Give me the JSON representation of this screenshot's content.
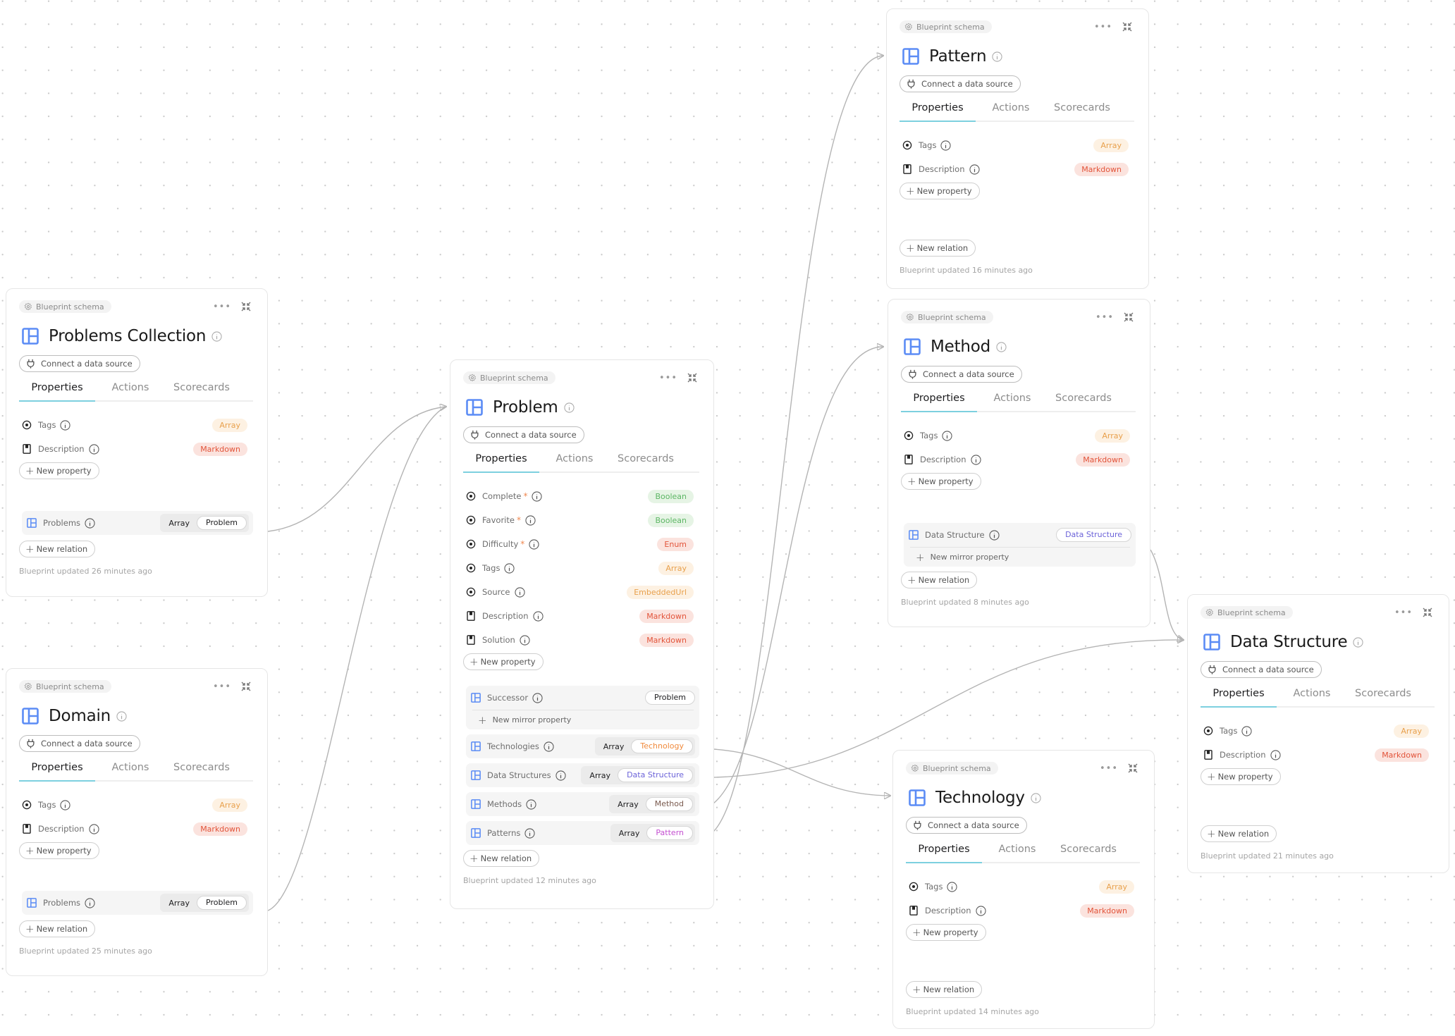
{
  "common": {
    "schema_chip": "Blueprint schema",
    "connect_label": "Connect a data source",
    "tabs": [
      "Properties",
      "Actions",
      "Scorecards"
    ],
    "new_property": "New property",
    "new_relation": "New relation",
    "new_mirror_property": "New mirror property",
    "array_label": "Array",
    "more_icon": "more-horizontal-icon",
    "collapse_icon": "collapse-icon",
    "colors": {
      "accent_tab": "#7dd0df",
      "blueprint_icon": "#5b8cf5",
      "array_badge": "#e8a04c",
      "markdown_badge": "#e2543a",
      "boolean_badge": "#5cb664",
      "enum_badge": "#e2543a"
    }
  },
  "blueprints": {
    "problems_collection": {
      "title": "Problems Collection",
      "properties": [
        {
          "name": "Tags",
          "icon": "tag-dot-icon",
          "type": "Array"
        },
        {
          "name": "Description",
          "icon": "document-icon",
          "type": "Markdown"
        }
      ],
      "relations": [
        {
          "name": "Problems",
          "many": "Array",
          "target": "Problem"
        }
      ],
      "updated": "Blueprint updated 26 minutes ago"
    },
    "domain": {
      "title": "Domain",
      "properties": [
        {
          "name": "Tags",
          "icon": "tag-dot-icon",
          "type": "Array"
        },
        {
          "name": "Description",
          "icon": "document-icon",
          "type": "Markdown"
        }
      ],
      "relations": [
        {
          "name": "Problems",
          "many": "Array",
          "target": "Problem"
        }
      ],
      "updated": "Blueprint updated 25 minutes ago"
    },
    "problem": {
      "title": "Problem",
      "properties": [
        {
          "name": "Complete",
          "required": "*",
          "icon": "tag-dot-icon",
          "type": "Boolean"
        },
        {
          "name": "Favorite",
          "required": "*",
          "icon": "tag-dot-icon",
          "type": "Boolean"
        },
        {
          "name": "Difficulty",
          "required": "*",
          "icon": "tag-dot-icon",
          "type": "Enum"
        },
        {
          "name": "Tags",
          "icon": "tag-dot-icon",
          "type": "Array"
        },
        {
          "name": "Source",
          "icon": "tag-dot-icon",
          "type": "EmbeddedUrl"
        },
        {
          "name": "Description",
          "icon": "document-icon",
          "type": "Markdown"
        },
        {
          "name": "Solution",
          "icon": "document-icon",
          "type": "Markdown"
        }
      ],
      "relations": [
        {
          "name": "Successor",
          "target": "Problem"
        },
        {
          "name": "Technologies",
          "many": "Array",
          "target": "Technology"
        },
        {
          "name": "Data Structures",
          "many": "Array",
          "target": "Data Structure"
        },
        {
          "name": "Methods",
          "many": "Array",
          "target": "Method"
        },
        {
          "name": "Patterns",
          "many": "Array",
          "target": "Pattern"
        }
      ],
      "updated": "Blueprint updated 12 minutes ago"
    },
    "pattern": {
      "title": "Pattern",
      "properties": [
        {
          "name": "Tags",
          "icon": "tag-dot-icon",
          "type": "Array"
        },
        {
          "name": "Description",
          "icon": "document-icon",
          "type": "Markdown"
        }
      ],
      "updated": "Blueprint updated 16 minutes ago"
    },
    "method": {
      "title": "Method",
      "properties": [
        {
          "name": "Tags",
          "icon": "tag-dot-icon",
          "type": "Array"
        },
        {
          "name": "Description",
          "icon": "document-icon",
          "type": "Markdown"
        }
      ],
      "relations": [
        {
          "name": "Data Structure",
          "target": "Data Structure"
        }
      ],
      "updated": "Blueprint updated 8 minutes ago"
    },
    "data_structure": {
      "title": "Data Structure",
      "properties": [
        {
          "name": "Tags",
          "icon": "tag-dot-icon",
          "type": "Array"
        },
        {
          "name": "Description",
          "icon": "document-icon",
          "type": "Markdown"
        }
      ],
      "updated": "Blueprint updated 21 minutes ago"
    },
    "technology": {
      "title": "Technology",
      "properties": [
        {
          "name": "Tags",
          "icon": "tag-dot-icon",
          "type": "Array"
        },
        {
          "name": "Description",
          "icon": "document-icon",
          "type": "Markdown"
        }
      ],
      "updated": "Blueprint updated 14 minutes ago"
    }
  },
  "edges": [
    {
      "from": "Problems Collection.Problems",
      "to": "Problem"
    },
    {
      "from": "Domain.Problems",
      "to": "Problem"
    },
    {
      "from": "Problem.Technologies",
      "to": "Technology"
    },
    {
      "from": "Problem.Data Structures",
      "to": "Data Structure"
    },
    {
      "from": "Problem.Methods",
      "to": "Method"
    },
    {
      "from": "Problem.Patterns",
      "to": "Pattern"
    },
    {
      "from": "Method.Data Structure",
      "to": "Data Structure"
    }
  ]
}
